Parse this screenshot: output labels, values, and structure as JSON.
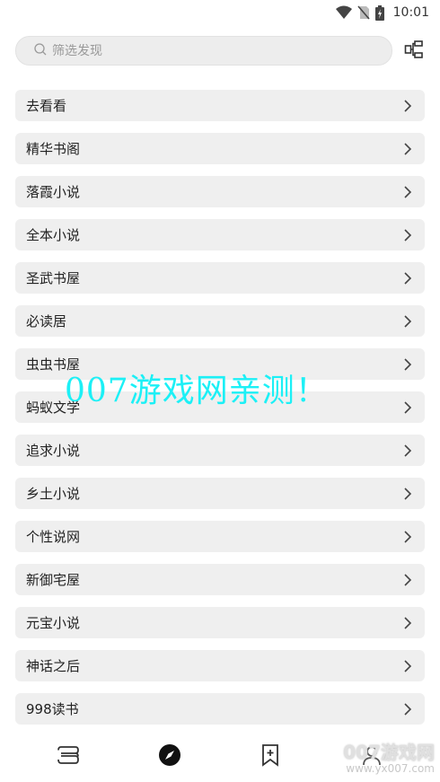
{
  "status": {
    "time": "10:01",
    "icons": [
      "wifi-icon",
      "no-sim-icon",
      "battery-charging-icon"
    ]
  },
  "search": {
    "placeholder": "筛选发现",
    "icon": "search-icon",
    "layout_icon": "layout-toggle-icon"
  },
  "items": [
    {
      "label": "去看看"
    },
    {
      "label": "精华书阁"
    },
    {
      "label": "落霞小说"
    },
    {
      "label": "全本小说"
    },
    {
      "label": "圣武书屋"
    },
    {
      "label": " 必读居"
    },
    {
      "label": "虫虫书屋"
    },
    {
      "label": "蚂蚁文学"
    },
    {
      "label": "追求小说"
    },
    {
      "label": "乡土小说"
    },
    {
      "label": " 个性说网"
    },
    {
      "label": " 新御宅屋"
    },
    {
      "label": " 元宝小说"
    },
    {
      "label": "神话之后"
    },
    {
      "label": "998读书"
    }
  ],
  "watermark": {
    "text": "007游戏网亲测！",
    "corner_top": "007游戏网",
    "corner_url": "www.yx007.com"
  },
  "nav": {
    "icons": [
      "bookshelf-icon",
      "explore-compass-icon",
      "bookmark-add-icon",
      "profile-icon"
    ]
  },
  "colors": {
    "item_bg": "#efefef",
    "search_bg": "#ededed",
    "watermark": "#1cf0f6"
  }
}
